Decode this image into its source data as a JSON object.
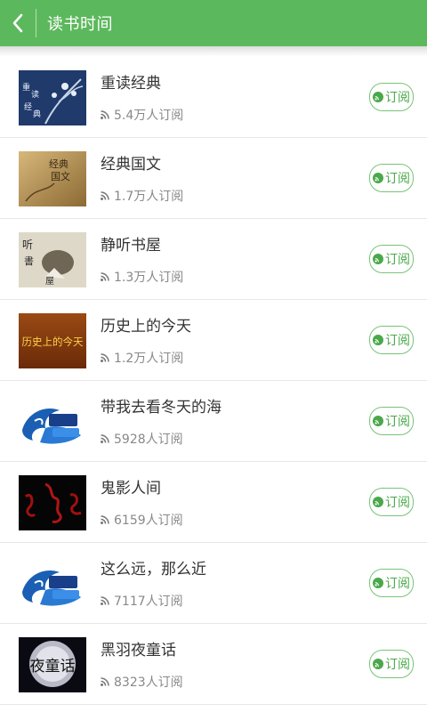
{
  "header": {
    "title": "读书时间",
    "color": "#5cb85c"
  },
  "icons": {
    "back": "chevron-left-icon",
    "rss": "rss-icon",
    "subscribe": "subscribe-icon"
  },
  "subscribe_label": "订阅",
  "items": [
    {
      "name": "重读经典",
      "subs": "5.4万人订阅"
    },
    {
      "name": "经典国文",
      "subs": "1.7万人订阅"
    },
    {
      "name": "静听书屋",
      "subs": "1.3万人订阅"
    },
    {
      "name": "历史上的今天",
      "subs": "1.2万人订阅",
      "thumb_text": "历史上的今天"
    },
    {
      "name": "带我去看冬天的海",
      "subs": "5928人订阅"
    },
    {
      "name": "鬼影人间",
      "subs": "6159人订阅"
    },
    {
      "name": "这么远，那么近",
      "subs": "7117人订阅"
    },
    {
      "name": "黑羽夜童话",
      "subs": "8323人订阅",
      "thumb_text": "夜童话"
    }
  ]
}
